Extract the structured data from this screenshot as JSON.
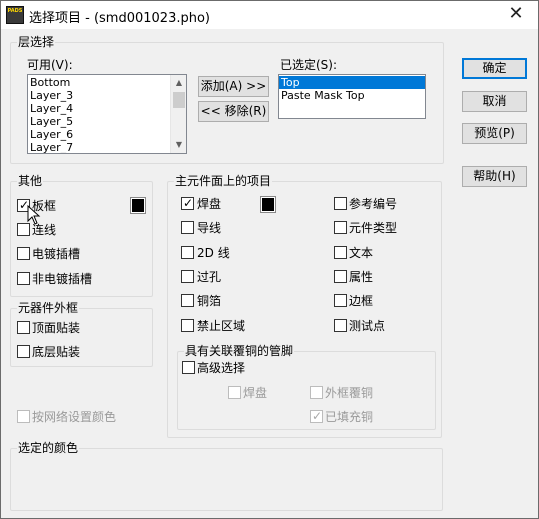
{
  "window": {
    "title": "选择项目 - (smd001023.pho)",
    "app_icon_text": "PADS",
    "close_glyph": "✕"
  },
  "layer_selection": {
    "group_label": "层选择",
    "available_label": "可用(V):",
    "available_items": [
      "Bottom",
      "Layer_3",
      "Layer_4",
      "Layer_5",
      "Layer_6",
      "Layer_7"
    ],
    "selected_label": "已选定(S):",
    "selected_items": [
      "Top",
      "Paste Mask Top"
    ],
    "selected_highlight": "Top",
    "add_button": "添加(A) >>",
    "remove_button": "<< 移除(R)"
  },
  "buttons": {
    "ok": "确定",
    "cancel": "取消",
    "preview": "预览(P)",
    "help": "帮助(H)"
  },
  "other": {
    "group_label": "其他",
    "board_outline": {
      "label": "板框",
      "checked": true
    },
    "connection": {
      "label": "连线",
      "checked": false
    },
    "plated_slot": {
      "label": "电镀插槽",
      "checked": false
    },
    "non_plated_slot": {
      "label": "非电镀插槽",
      "checked": false
    },
    "swatch_color": "#000000"
  },
  "component_outline": {
    "group_label": "元器件外框",
    "top_mount": {
      "label": "顶面贴装",
      "checked": false
    },
    "bottom_mount": {
      "label": "底层贴装",
      "checked": false
    }
  },
  "net_color": {
    "label": "按网络设置颜色",
    "checked": false,
    "disabled": true
  },
  "main_items": {
    "group_label": "主元件面上的项目",
    "pad": {
      "label": "焊盘",
      "checked": true
    },
    "trace": {
      "label": "导线",
      "checked": false
    },
    "line_2d": {
      "label": "2D 线",
      "checked": false
    },
    "via": {
      "label": "过孔",
      "checked": false
    },
    "copper": {
      "label": "铜箔",
      "checked": false
    },
    "keepout": {
      "label": "禁止区域",
      "checked": false
    },
    "ref_des": {
      "label": "参考编号",
      "checked": false
    },
    "part_type": {
      "label": "元件类型",
      "checked": false
    },
    "text": {
      "label": "文本",
      "checked": false
    },
    "attribute": {
      "label": "属性",
      "checked": false
    },
    "border": {
      "label": "边框",
      "checked": false
    },
    "test_point": {
      "label": "测试点",
      "checked": false
    },
    "swatch_color": "#000000"
  },
  "copper_pins": {
    "group_label": "具有关联覆铜的管脚",
    "advanced": {
      "label": "高级选择",
      "checked": false
    },
    "pad": {
      "label": "焊盘",
      "checked": false
    },
    "outline_pour": {
      "label": "外框覆铜",
      "checked": false
    },
    "filled_pour": {
      "label": "已填充铜",
      "checked": true
    }
  },
  "selected_colors": {
    "group_label": "选定的颜色"
  }
}
